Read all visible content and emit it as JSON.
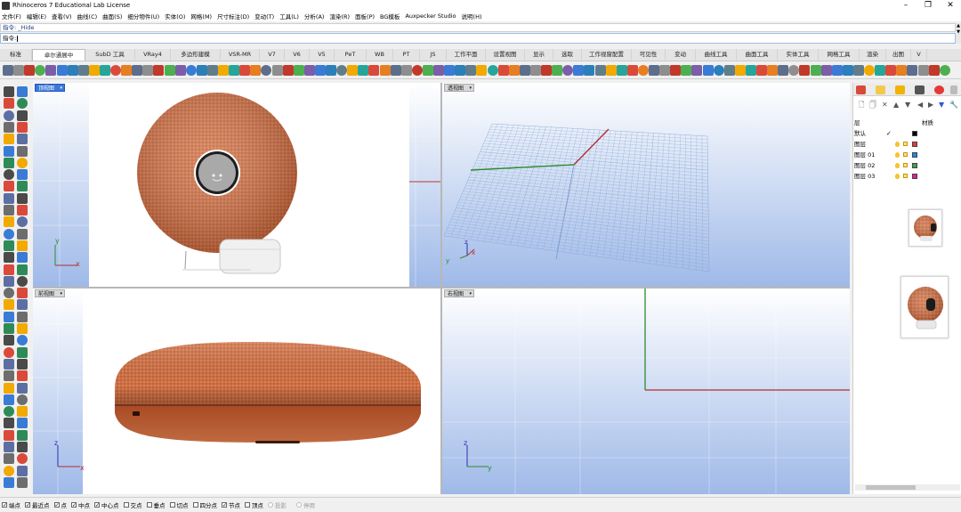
{
  "app": {
    "title": "Rhinoceros 7 Educational Lab License",
    "window_controls": [
      "–",
      "❐",
      "✕"
    ]
  },
  "menu": [
    "文件(F)",
    "编辑(E)",
    "查看(V)",
    "曲线(C)",
    "曲面(S)",
    "细分物件(U)",
    "实体(O)",
    "网格(M)",
    "尺寸标注(D)",
    "变动(T)",
    "工具(L)",
    "分析(A)",
    "渲染(R)",
    "面板(P)",
    "BG模板",
    "Auxpecker Studio",
    "说明(H)"
  ],
  "command": {
    "history": "指令: _Hide",
    "prompt": "指令:"
  },
  "tabs": [
    "标准",
    "卓尔通展中",
    "SubD 工具",
    "VRay4",
    "多边形建模",
    "VSR-MR",
    "V7",
    "V6",
    "V5",
    "PeT",
    "WB",
    "PT",
    "JS",
    "工作平面",
    "设置视图",
    "显示",
    "选取",
    "工作视窗配置",
    "可见性",
    "变动",
    "曲线工具",
    "曲面工具",
    "实体工具",
    "网格工具",
    "渲染",
    "出图",
    "V"
  ],
  "active_tab_index": 1,
  "viewports": {
    "top": {
      "label": "顶视图"
    },
    "perspective": {
      "label": "透视图"
    },
    "front": {
      "label": "前视图"
    },
    "right": {
      "label": "右视图"
    }
  },
  "axes": {
    "x": "x",
    "y": "y",
    "z": "z"
  },
  "layers": {
    "headers": {
      "name": "层",
      "material": "材质"
    },
    "rows": [
      {
        "name": "默认",
        "current": "✓",
        "color": "#000000"
      },
      {
        "name": "图层",
        "current": "",
        "color": "#e53935"
      },
      {
        "name": "图层 01",
        "current": "",
        "color": "#1e88e5"
      },
      {
        "name": "图层 02",
        "current": "",
        "color": "#43a047"
      },
      {
        "name": "图层 03",
        "current": "",
        "color": "#e91e8c"
      }
    ]
  },
  "osnaps": [
    {
      "label": "端点",
      "checked": true
    },
    {
      "label": "最近点",
      "checked": true
    },
    {
      "label": "点",
      "checked": true
    },
    {
      "label": "中点",
      "checked": true
    },
    {
      "label": "中心点",
      "checked": true
    },
    {
      "label": "交点",
      "checked": false
    },
    {
      "label": "垂点",
      "checked": false
    },
    {
      "label": "切点",
      "checked": false
    },
    {
      "label": "四分点",
      "checked": false
    },
    {
      "label": "节点",
      "checked": true
    },
    {
      "label": "顶点",
      "checked": false
    },
    {
      "label": "投影",
      "checked": false,
      "disabled": true
    },
    {
      "label": "停用",
      "checked": false,
      "disabled": true
    }
  ],
  "colors": {
    "accent": "#3d79d9",
    "viewport_top": "#ffffff",
    "viewport_bottom": "#9fb9e8",
    "fabric": "#cf7045",
    "x_axis": "#b03030",
    "y_axis": "#2e8b2e"
  }
}
